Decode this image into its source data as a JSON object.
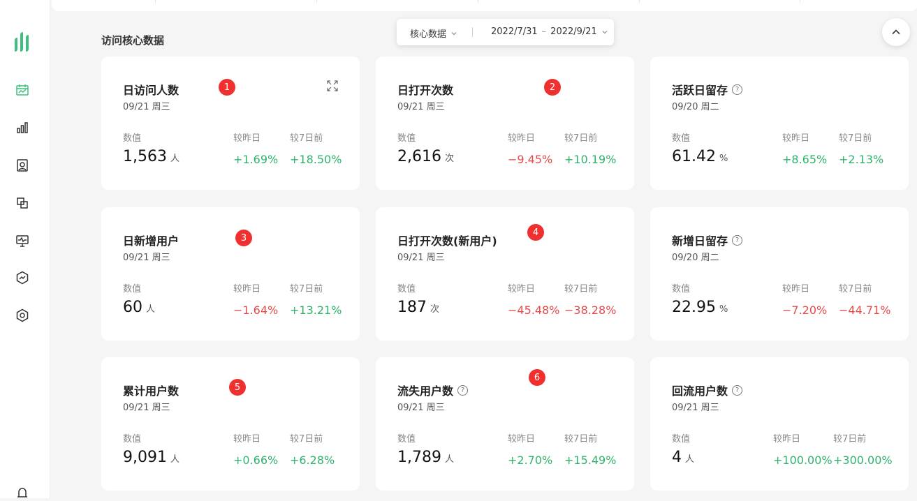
{
  "section_title": "访问核心数据",
  "filter": {
    "metric": "核心数据",
    "date_start": "2022/7/31",
    "date_sep": "–",
    "date_end": "2022/9/21"
  },
  "labels": {
    "value": "数值",
    "vs_yesterday": "较昨日",
    "vs_7days": "较7日前"
  },
  "cards": [
    {
      "title": "日访问人数",
      "date": "09/21 周三",
      "value": "1,563",
      "unit": "人",
      "d1": "+1.69%",
      "d7": "+18.50%",
      "badge": "1"
    },
    {
      "title": "日打开次数",
      "date": "09/21 周三",
      "value": "2,616",
      "unit": "次",
      "d1": "−9.45%",
      "d7": "+10.19%",
      "badge": "2"
    },
    {
      "title": "活跃日留存",
      "date": "09/20 周二",
      "value": "61.42",
      "unit": "%",
      "d1": "+8.65%",
      "d7": "+2.13%"
    },
    {
      "title": "日新增用户",
      "date": "09/21 周三",
      "value": "60",
      "unit": "人",
      "d1": "−1.64%",
      "d7": "+13.21%",
      "badge": "3"
    },
    {
      "title": "日打开次数(新用户)",
      "date": "09/21 周三",
      "value": "187",
      "unit": "次",
      "d1": "−45.48%",
      "d7": "−38.28%",
      "badge": "4"
    },
    {
      "title": "新增日留存",
      "date": "09/20 周二",
      "value": "22.95",
      "unit": "%",
      "d1": "−7.20%",
      "d7": "−44.71%"
    },
    {
      "title": "累计用户数",
      "date": "09/21 周三",
      "value": "9,091",
      "unit": "人",
      "d1": "+0.66%",
      "d7": "+6.28%",
      "badge": "5"
    },
    {
      "title": "流失用户数",
      "date": "09/21 周三",
      "value": "1,789",
      "unit": "人",
      "d1": "+2.70%",
      "d7": "+15.49%",
      "badge": "6"
    },
    {
      "title": "回流用户数",
      "date": "09/21 周三",
      "value": "4",
      "unit": "人",
      "d1": "+100.00%",
      "d7": "+300.00%"
    }
  ],
  "help_glyph": "?",
  "colors": {
    "accent": "#3fbf7f",
    "positive": "#2fb36b",
    "negative": "#e34b4b",
    "badge": "#f0302e"
  }
}
